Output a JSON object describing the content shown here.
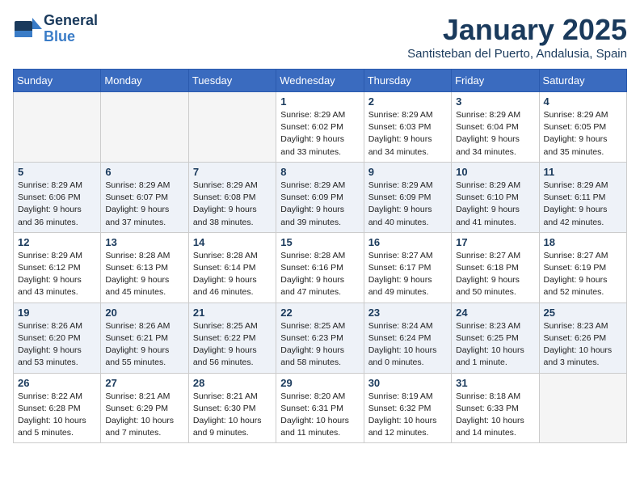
{
  "header": {
    "logo_line1": "General",
    "logo_line2": "Blue",
    "month": "January 2025",
    "location": "Santisteban del Puerto, Andalusia, Spain"
  },
  "weekdays": [
    "Sunday",
    "Monday",
    "Tuesday",
    "Wednesday",
    "Thursday",
    "Friday",
    "Saturday"
  ],
  "weeks": [
    [
      {
        "day": "",
        "info": ""
      },
      {
        "day": "",
        "info": ""
      },
      {
        "day": "",
        "info": ""
      },
      {
        "day": "1",
        "info": "Sunrise: 8:29 AM\nSunset: 6:02 PM\nDaylight: 9 hours\nand 33 minutes."
      },
      {
        "day": "2",
        "info": "Sunrise: 8:29 AM\nSunset: 6:03 PM\nDaylight: 9 hours\nand 34 minutes."
      },
      {
        "day": "3",
        "info": "Sunrise: 8:29 AM\nSunset: 6:04 PM\nDaylight: 9 hours\nand 34 minutes."
      },
      {
        "day": "4",
        "info": "Sunrise: 8:29 AM\nSunset: 6:05 PM\nDaylight: 9 hours\nand 35 minutes."
      }
    ],
    [
      {
        "day": "5",
        "info": "Sunrise: 8:29 AM\nSunset: 6:06 PM\nDaylight: 9 hours\nand 36 minutes."
      },
      {
        "day": "6",
        "info": "Sunrise: 8:29 AM\nSunset: 6:07 PM\nDaylight: 9 hours\nand 37 minutes."
      },
      {
        "day": "7",
        "info": "Sunrise: 8:29 AM\nSunset: 6:08 PM\nDaylight: 9 hours\nand 38 minutes."
      },
      {
        "day": "8",
        "info": "Sunrise: 8:29 AM\nSunset: 6:09 PM\nDaylight: 9 hours\nand 39 minutes."
      },
      {
        "day": "9",
        "info": "Sunrise: 8:29 AM\nSunset: 6:09 PM\nDaylight: 9 hours\nand 40 minutes."
      },
      {
        "day": "10",
        "info": "Sunrise: 8:29 AM\nSunset: 6:10 PM\nDaylight: 9 hours\nand 41 minutes."
      },
      {
        "day": "11",
        "info": "Sunrise: 8:29 AM\nSunset: 6:11 PM\nDaylight: 9 hours\nand 42 minutes."
      }
    ],
    [
      {
        "day": "12",
        "info": "Sunrise: 8:29 AM\nSunset: 6:12 PM\nDaylight: 9 hours\nand 43 minutes."
      },
      {
        "day": "13",
        "info": "Sunrise: 8:28 AM\nSunset: 6:13 PM\nDaylight: 9 hours\nand 45 minutes."
      },
      {
        "day": "14",
        "info": "Sunrise: 8:28 AM\nSunset: 6:14 PM\nDaylight: 9 hours\nand 46 minutes."
      },
      {
        "day": "15",
        "info": "Sunrise: 8:28 AM\nSunset: 6:16 PM\nDaylight: 9 hours\nand 47 minutes."
      },
      {
        "day": "16",
        "info": "Sunrise: 8:27 AM\nSunset: 6:17 PM\nDaylight: 9 hours\nand 49 minutes."
      },
      {
        "day": "17",
        "info": "Sunrise: 8:27 AM\nSunset: 6:18 PM\nDaylight: 9 hours\nand 50 minutes."
      },
      {
        "day": "18",
        "info": "Sunrise: 8:27 AM\nSunset: 6:19 PM\nDaylight: 9 hours\nand 52 minutes."
      }
    ],
    [
      {
        "day": "19",
        "info": "Sunrise: 8:26 AM\nSunset: 6:20 PM\nDaylight: 9 hours\nand 53 minutes."
      },
      {
        "day": "20",
        "info": "Sunrise: 8:26 AM\nSunset: 6:21 PM\nDaylight: 9 hours\nand 55 minutes."
      },
      {
        "day": "21",
        "info": "Sunrise: 8:25 AM\nSunset: 6:22 PM\nDaylight: 9 hours\nand 56 minutes."
      },
      {
        "day": "22",
        "info": "Sunrise: 8:25 AM\nSunset: 6:23 PM\nDaylight: 9 hours\nand 58 minutes."
      },
      {
        "day": "23",
        "info": "Sunrise: 8:24 AM\nSunset: 6:24 PM\nDaylight: 10 hours\nand 0 minutes."
      },
      {
        "day": "24",
        "info": "Sunrise: 8:23 AM\nSunset: 6:25 PM\nDaylight: 10 hours\nand 1 minute."
      },
      {
        "day": "25",
        "info": "Sunrise: 8:23 AM\nSunset: 6:26 PM\nDaylight: 10 hours\nand 3 minutes."
      }
    ],
    [
      {
        "day": "26",
        "info": "Sunrise: 8:22 AM\nSunset: 6:28 PM\nDaylight: 10 hours\nand 5 minutes."
      },
      {
        "day": "27",
        "info": "Sunrise: 8:21 AM\nSunset: 6:29 PM\nDaylight: 10 hours\nand 7 minutes."
      },
      {
        "day": "28",
        "info": "Sunrise: 8:21 AM\nSunset: 6:30 PM\nDaylight: 10 hours\nand 9 minutes."
      },
      {
        "day": "29",
        "info": "Sunrise: 8:20 AM\nSunset: 6:31 PM\nDaylight: 10 hours\nand 11 minutes."
      },
      {
        "day": "30",
        "info": "Sunrise: 8:19 AM\nSunset: 6:32 PM\nDaylight: 10 hours\nand 12 minutes."
      },
      {
        "day": "31",
        "info": "Sunrise: 8:18 AM\nSunset: 6:33 PM\nDaylight: 10 hours\nand 14 minutes."
      },
      {
        "day": "",
        "info": ""
      }
    ]
  ]
}
